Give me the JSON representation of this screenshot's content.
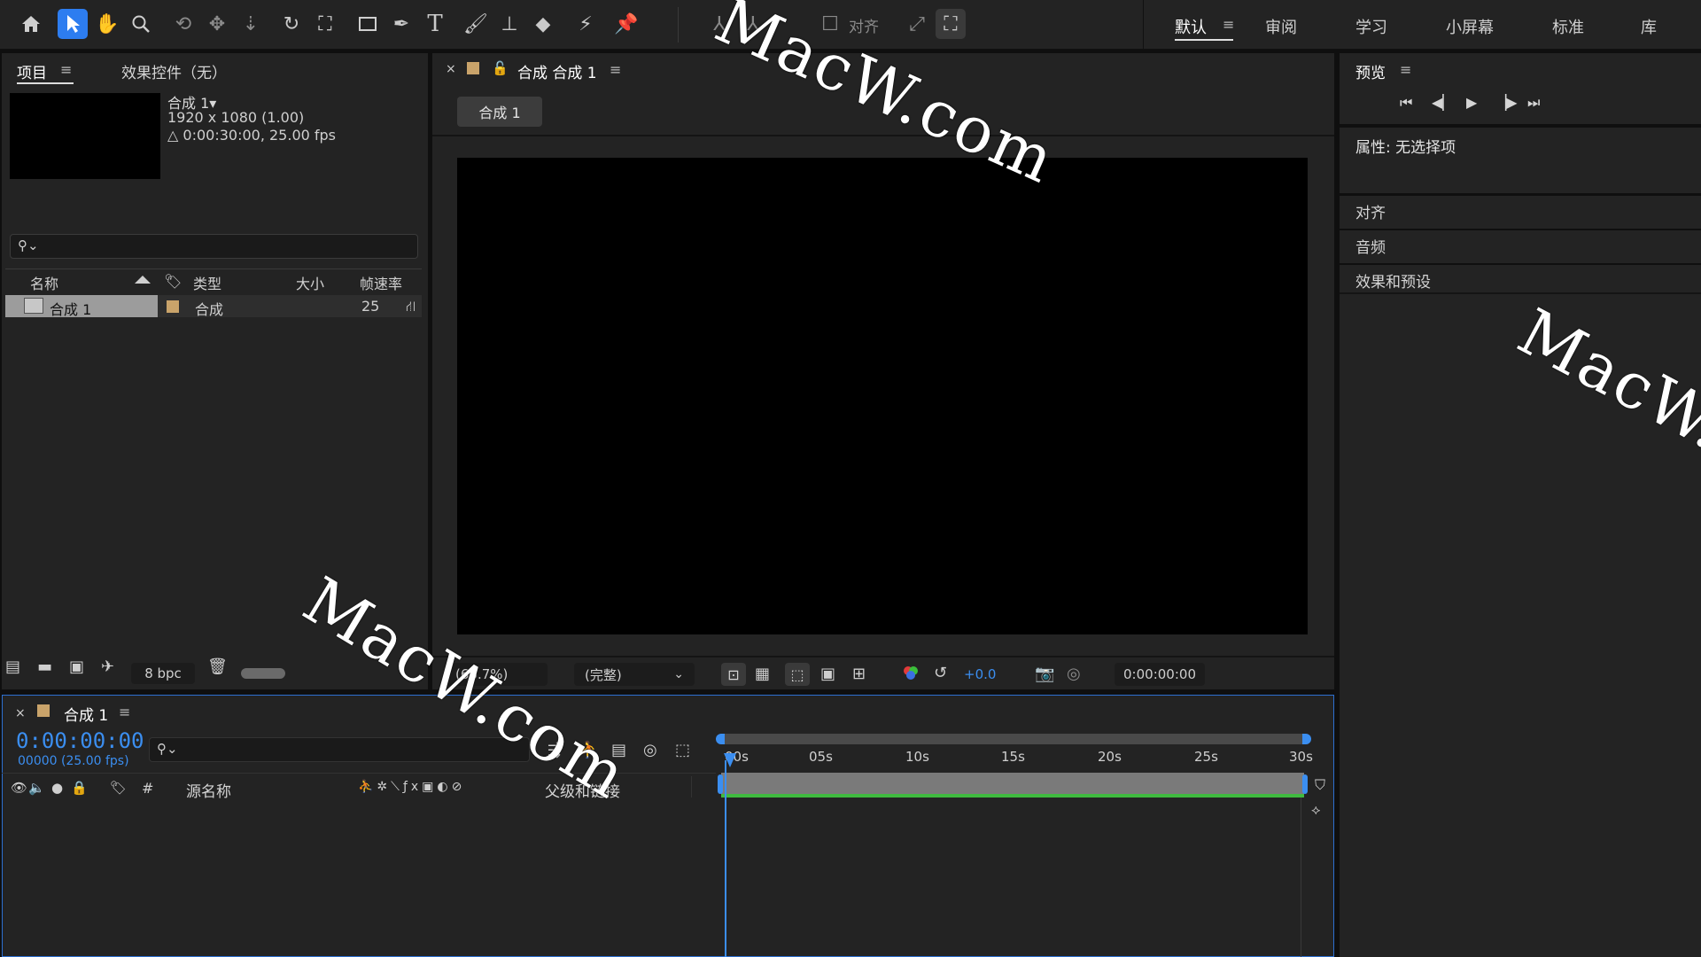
{
  "toolbar": {
    "align_label": "对齐",
    "workspaces": [
      "默认",
      "审阅",
      "学习",
      "小屏幕",
      "标准",
      "库"
    ]
  },
  "project_panel": {
    "tab_project": "项目",
    "tab_effects": "效果控件（无）",
    "comp_name": "合成 1▾",
    "comp_size": "1920 x 1080 (1.00)",
    "comp_duration": "△ 0:00:30:00, 25.00 fps",
    "columns": {
      "name": "名称",
      "type": "类型",
      "size": "大小",
      "fps": "帧速率"
    },
    "rows": [
      {
        "name": "合成 1",
        "type": "合成",
        "fps": "25"
      }
    ],
    "bpc": "8 bpc"
  },
  "comp_panel": {
    "title": "合成 合成 1",
    "breadcrumb": "合成 1",
    "zoom": "(66.7%)",
    "resolution": "(完整)",
    "exposure": "+0.0",
    "timecode": "0:00:00:00"
  },
  "right_panel": {
    "preview_title": "预览",
    "properties": "属性: 无选择项",
    "sections": [
      "对齐",
      "音频",
      "效果和预设"
    ]
  },
  "timeline": {
    "tab_title": "合成 1",
    "timecode": "0:00:00:00",
    "frames": "00000 (25.00 fps)",
    "col_source": "源名称",
    "col_parent": "父级和链接",
    "col_number": "#",
    "ruler": [
      "00s",
      "05s",
      "10s",
      "15s",
      "20s",
      "25s",
      "30s"
    ]
  },
  "watermarks": [
    "MacW.com",
    "MacW.com",
    "MacW.c"
  ],
  "colors": {
    "accent": "#2d7df0",
    "timecode": "#3b8ef0",
    "label_tan": "#c9a36a",
    "work_area": "#3fba3f"
  }
}
